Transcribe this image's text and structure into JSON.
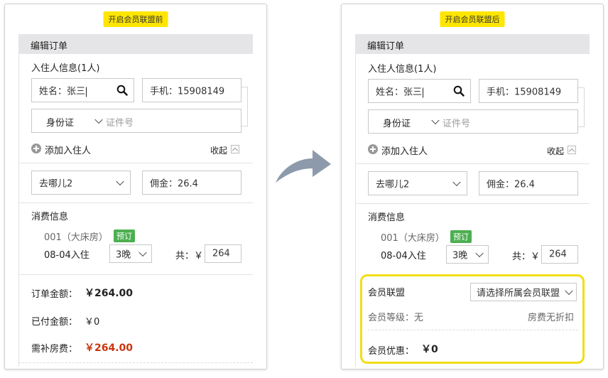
{
  "left": {
    "tag": "开启会员联盟前",
    "header": "编辑订单",
    "guest_section": "入住人信息(1人)",
    "name_value": "姓名：张三",
    "phone_value": "手机：15908149",
    "id_type": "身份证",
    "id_placeholder": "证件号",
    "add_guest": "添加入住人",
    "collapse": "收起",
    "channel": "去哪儿2",
    "commission": "佣金：26.4",
    "consumption": "消费信息",
    "room": "001（大床房）",
    "room_badge": "预订",
    "checkin": "08-04入住",
    "nights": "3晚",
    "total_label": "共：￥",
    "total_value": "264",
    "order_amount_label": "订单金额：",
    "order_amount": "￥264.00",
    "paid_label": "已付金额：",
    "paid": "￥0",
    "due_label": "需补房费：",
    "due": "￥264.00"
  },
  "right": {
    "tag": "开启会员联盟后",
    "header": "编辑订单",
    "guest_section": "入住人信息(1人)",
    "name_value": "姓名：张三",
    "phone_value": "手机：15908149",
    "id_type": "身份证",
    "id_placeholder": "证件号",
    "add_guest": "添加入住人",
    "collapse": "收起",
    "channel": "去哪儿2",
    "commission": "佣金：26.4",
    "consumption": "消费信息",
    "room": "001（大床房）",
    "room_badge": "预订",
    "checkin": "08-04入住",
    "nights": "3晚",
    "total_label": "共：￥",
    "total_value": "264",
    "member_alliance": "会员联盟",
    "alliance_select": "请选择所属会员联盟",
    "member_level": "会员等级：无",
    "no_discount": "房费无折扣",
    "member_discount_label": "会员优惠：",
    "member_discount": "￥0"
  },
  "colors": {
    "highlight": "#f2dd16",
    "tag": "#ffe600",
    "badge": "#4caf50",
    "due": "#c8360f",
    "arrow": "#8c9aab"
  },
  "icons": {
    "search": "search-icon",
    "arrow": "curved-arrow-icon",
    "add": "plus-circle-icon",
    "collapse": "chevron-up-icon"
  }
}
